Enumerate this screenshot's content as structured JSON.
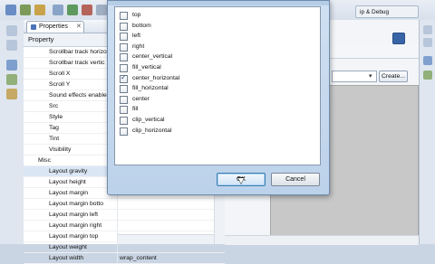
{
  "props_panel": {
    "tab_label": "Properties",
    "close_glyph": "✕",
    "header_label": "Property",
    "rows": [
      {
        "name": "Scrollbar track horizo",
        "value": "",
        "section": false,
        "selected": false
      },
      {
        "name": "Scrollbar track vertic",
        "value": "",
        "section": false,
        "selected": false
      },
      {
        "name": "Scroll X",
        "value": "",
        "section": false,
        "selected": false
      },
      {
        "name": "Scroll Y",
        "value": "",
        "section": false,
        "selected": false
      },
      {
        "name": "Sound effects enable",
        "value": "",
        "section": false,
        "selected": false
      },
      {
        "name": "Src",
        "value": "",
        "section": false,
        "selected": false
      },
      {
        "name": "Style",
        "value": "",
        "section": false,
        "selected": false
      },
      {
        "name": "Tag",
        "value": "",
        "section": false,
        "selected": false
      },
      {
        "name": "Tint",
        "value": "",
        "section": false,
        "selected": false
      },
      {
        "name": "Visibility",
        "value": "",
        "section": false,
        "selected": false
      },
      {
        "name": "Misc",
        "value": "",
        "section": true,
        "selected": false
      },
      {
        "name": "Layout gravity",
        "value": "",
        "section": false,
        "selected": true
      },
      {
        "name": "Layout height",
        "value": "",
        "section": false,
        "selected": false
      },
      {
        "name": "Layout margin",
        "value": "",
        "section": false,
        "selected": false
      },
      {
        "name": "Layout margin botto",
        "value": "",
        "section": false,
        "selected": false
      },
      {
        "name": "Layout margin left",
        "value": "",
        "section": false,
        "selected": false
      },
      {
        "name": "Layout margin right",
        "value": "",
        "section": false,
        "selected": false
      },
      {
        "name": "Layout margin top",
        "value": "",
        "section": false,
        "selected": false
      },
      {
        "name": "Layout weight",
        "value": "",
        "section": false,
        "selected": false
      },
      {
        "name": "Layout width",
        "value": "wrap_content",
        "section": false,
        "selected": false
      }
    ]
  },
  "dialog": {
    "options": [
      {
        "label": "top",
        "checked": false
      },
      {
        "label": "bottom",
        "checked": false
      },
      {
        "label": "left",
        "checked": false
      },
      {
        "label": "right",
        "checked": false
      },
      {
        "label": "center_vertical",
        "checked": false
      },
      {
        "label": "fill_vertical",
        "checked": false
      },
      {
        "label": "center_horizontal",
        "checked": true
      },
      {
        "label": "fill_horizontal",
        "checked": false
      },
      {
        "label": "center",
        "checked": false
      },
      {
        "label": "fill",
        "checked": false
      },
      {
        "label": "clip_vertical",
        "checked": false
      },
      {
        "label": "clip_horizontal",
        "checked": false
      }
    ],
    "ok_label": "OK",
    "cancel_label": "Cancel"
  },
  "editor": {
    "create_label": "Create...",
    "select_arrow": "▾",
    "top_right_label": "ip & Debug"
  },
  "colors": {
    "accent": "#3c7fb1",
    "selection": "#dbe6f5",
    "canvas": "#c8c8c8"
  }
}
